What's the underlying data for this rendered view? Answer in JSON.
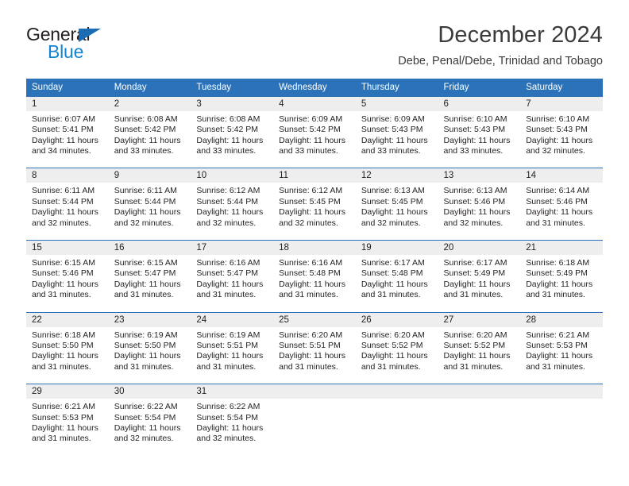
{
  "brand": {
    "name_part1": "General",
    "name_part2": "Blue",
    "triangle_color": "#1c6cb4",
    "blue_color": "#1383d2"
  },
  "header": {
    "title": "December 2024",
    "subtitle": "Debe, Penal/Debe, Trinidad and Tobago"
  },
  "theme": {
    "header_blue": "#2b72b8",
    "daynum_gray": "#eeeeee",
    "text": "#231f20"
  },
  "calendar": {
    "weekday_headers": [
      "Sunday",
      "Monday",
      "Tuesday",
      "Wednesday",
      "Thursday",
      "Friday",
      "Saturday"
    ],
    "weeks": [
      [
        {
          "day": "1",
          "sunrise": "Sunrise: 6:07 AM",
          "sunset": "Sunset: 5:41 PM",
          "daylight_line1": "Daylight: 11 hours",
          "daylight_line2": "and 34 minutes."
        },
        {
          "day": "2",
          "sunrise": "Sunrise: 6:08 AM",
          "sunset": "Sunset: 5:42 PM",
          "daylight_line1": "Daylight: 11 hours",
          "daylight_line2": "and 33 minutes."
        },
        {
          "day": "3",
          "sunrise": "Sunrise: 6:08 AM",
          "sunset": "Sunset: 5:42 PM",
          "daylight_line1": "Daylight: 11 hours",
          "daylight_line2": "and 33 minutes."
        },
        {
          "day": "4",
          "sunrise": "Sunrise: 6:09 AM",
          "sunset": "Sunset: 5:42 PM",
          "daylight_line1": "Daylight: 11 hours",
          "daylight_line2": "and 33 minutes."
        },
        {
          "day": "5",
          "sunrise": "Sunrise: 6:09 AM",
          "sunset": "Sunset: 5:43 PM",
          "daylight_line1": "Daylight: 11 hours",
          "daylight_line2": "and 33 minutes."
        },
        {
          "day": "6",
          "sunrise": "Sunrise: 6:10 AM",
          "sunset": "Sunset: 5:43 PM",
          "daylight_line1": "Daylight: 11 hours",
          "daylight_line2": "and 33 minutes."
        },
        {
          "day": "7",
          "sunrise": "Sunrise: 6:10 AM",
          "sunset": "Sunset: 5:43 PM",
          "daylight_line1": "Daylight: 11 hours",
          "daylight_line2": "and 32 minutes."
        }
      ],
      [
        {
          "day": "8",
          "sunrise": "Sunrise: 6:11 AM",
          "sunset": "Sunset: 5:44 PM",
          "daylight_line1": "Daylight: 11 hours",
          "daylight_line2": "and 32 minutes."
        },
        {
          "day": "9",
          "sunrise": "Sunrise: 6:11 AM",
          "sunset": "Sunset: 5:44 PM",
          "daylight_line1": "Daylight: 11 hours",
          "daylight_line2": "and 32 minutes."
        },
        {
          "day": "10",
          "sunrise": "Sunrise: 6:12 AM",
          "sunset": "Sunset: 5:44 PM",
          "daylight_line1": "Daylight: 11 hours",
          "daylight_line2": "and 32 minutes."
        },
        {
          "day": "11",
          "sunrise": "Sunrise: 6:12 AM",
          "sunset": "Sunset: 5:45 PM",
          "daylight_line1": "Daylight: 11 hours",
          "daylight_line2": "and 32 minutes."
        },
        {
          "day": "12",
          "sunrise": "Sunrise: 6:13 AM",
          "sunset": "Sunset: 5:45 PM",
          "daylight_line1": "Daylight: 11 hours",
          "daylight_line2": "and 32 minutes."
        },
        {
          "day": "13",
          "sunrise": "Sunrise: 6:13 AM",
          "sunset": "Sunset: 5:46 PM",
          "daylight_line1": "Daylight: 11 hours",
          "daylight_line2": "and 32 minutes."
        },
        {
          "day": "14",
          "sunrise": "Sunrise: 6:14 AM",
          "sunset": "Sunset: 5:46 PM",
          "daylight_line1": "Daylight: 11 hours",
          "daylight_line2": "and 31 minutes."
        }
      ],
      [
        {
          "day": "15",
          "sunrise": "Sunrise: 6:15 AM",
          "sunset": "Sunset: 5:46 PM",
          "daylight_line1": "Daylight: 11 hours",
          "daylight_line2": "and 31 minutes."
        },
        {
          "day": "16",
          "sunrise": "Sunrise: 6:15 AM",
          "sunset": "Sunset: 5:47 PM",
          "daylight_line1": "Daylight: 11 hours",
          "daylight_line2": "and 31 minutes."
        },
        {
          "day": "17",
          "sunrise": "Sunrise: 6:16 AM",
          "sunset": "Sunset: 5:47 PM",
          "daylight_line1": "Daylight: 11 hours",
          "daylight_line2": "and 31 minutes."
        },
        {
          "day": "18",
          "sunrise": "Sunrise: 6:16 AM",
          "sunset": "Sunset: 5:48 PM",
          "daylight_line1": "Daylight: 11 hours",
          "daylight_line2": "and 31 minutes."
        },
        {
          "day": "19",
          "sunrise": "Sunrise: 6:17 AM",
          "sunset": "Sunset: 5:48 PM",
          "daylight_line1": "Daylight: 11 hours",
          "daylight_line2": "and 31 minutes."
        },
        {
          "day": "20",
          "sunrise": "Sunrise: 6:17 AM",
          "sunset": "Sunset: 5:49 PM",
          "daylight_line1": "Daylight: 11 hours",
          "daylight_line2": "and 31 minutes."
        },
        {
          "day": "21",
          "sunrise": "Sunrise: 6:18 AM",
          "sunset": "Sunset: 5:49 PM",
          "daylight_line1": "Daylight: 11 hours",
          "daylight_line2": "and 31 minutes."
        }
      ],
      [
        {
          "day": "22",
          "sunrise": "Sunrise: 6:18 AM",
          "sunset": "Sunset: 5:50 PM",
          "daylight_line1": "Daylight: 11 hours",
          "daylight_line2": "and 31 minutes."
        },
        {
          "day": "23",
          "sunrise": "Sunrise: 6:19 AM",
          "sunset": "Sunset: 5:50 PM",
          "daylight_line1": "Daylight: 11 hours",
          "daylight_line2": "and 31 minutes."
        },
        {
          "day": "24",
          "sunrise": "Sunrise: 6:19 AM",
          "sunset": "Sunset: 5:51 PM",
          "daylight_line1": "Daylight: 11 hours",
          "daylight_line2": "and 31 minutes."
        },
        {
          "day": "25",
          "sunrise": "Sunrise: 6:20 AM",
          "sunset": "Sunset: 5:51 PM",
          "daylight_line1": "Daylight: 11 hours",
          "daylight_line2": "and 31 minutes."
        },
        {
          "day": "26",
          "sunrise": "Sunrise: 6:20 AM",
          "sunset": "Sunset: 5:52 PM",
          "daylight_line1": "Daylight: 11 hours",
          "daylight_line2": "and 31 minutes."
        },
        {
          "day": "27",
          "sunrise": "Sunrise: 6:20 AM",
          "sunset": "Sunset: 5:52 PM",
          "daylight_line1": "Daylight: 11 hours",
          "daylight_line2": "and 31 minutes."
        },
        {
          "day": "28",
          "sunrise": "Sunrise: 6:21 AM",
          "sunset": "Sunset: 5:53 PM",
          "daylight_line1": "Daylight: 11 hours",
          "daylight_line2": "and 31 minutes."
        }
      ],
      [
        {
          "day": "29",
          "sunrise": "Sunrise: 6:21 AM",
          "sunset": "Sunset: 5:53 PM",
          "daylight_line1": "Daylight: 11 hours",
          "daylight_line2": "and 31 minutes."
        },
        {
          "day": "30",
          "sunrise": "Sunrise: 6:22 AM",
          "sunset": "Sunset: 5:54 PM",
          "daylight_line1": "Daylight: 11 hours",
          "daylight_line2": "and 32 minutes."
        },
        {
          "day": "31",
          "sunrise": "Sunrise: 6:22 AM",
          "sunset": "Sunset: 5:54 PM",
          "daylight_line1": "Daylight: 11 hours",
          "daylight_line2": "and 32 minutes."
        },
        {
          "day": "",
          "sunrise": "",
          "sunset": "",
          "daylight_line1": "",
          "daylight_line2": ""
        },
        {
          "day": "",
          "sunrise": "",
          "sunset": "",
          "daylight_line1": "",
          "daylight_line2": ""
        },
        {
          "day": "",
          "sunrise": "",
          "sunset": "",
          "daylight_line1": "",
          "daylight_line2": ""
        },
        {
          "day": "",
          "sunrise": "",
          "sunset": "",
          "daylight_line1": "",
          "daylight_line2": ""
        }
      ]
    ]
  }
}
